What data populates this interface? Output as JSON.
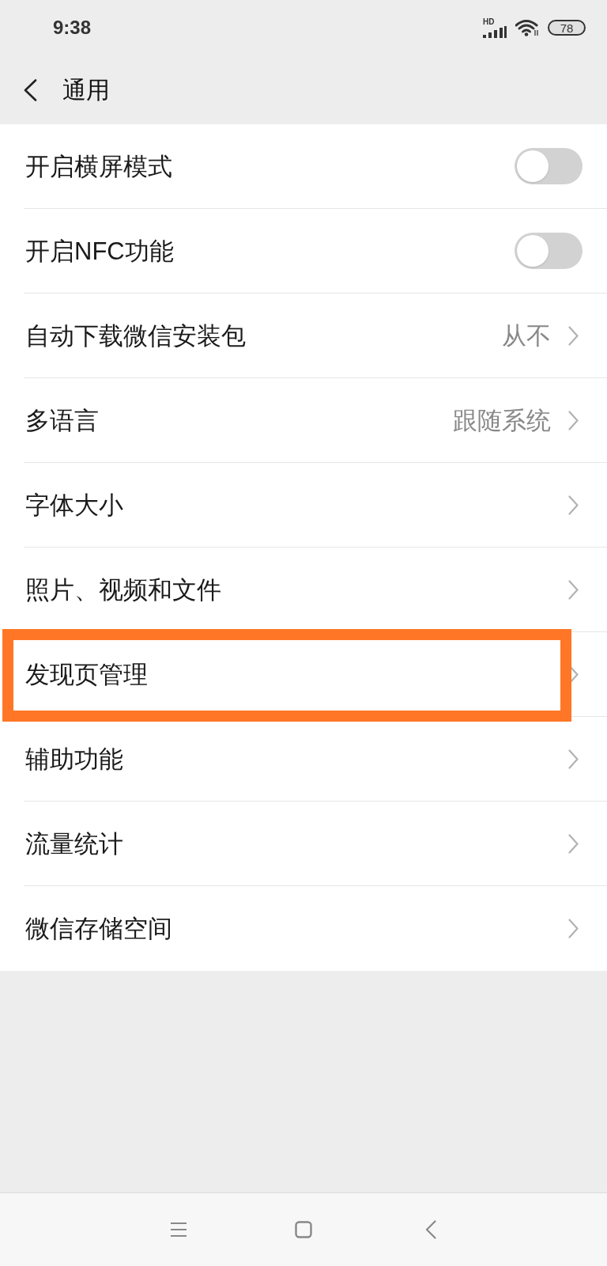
{
  "status_bar": {
    "time": "9:38",
    "network": "HD",
    "battery": "78"
  },
  "header": {
    "title": "通用"
  },
  "items": [
    {
      "kind": "toggle",
      "label": "开启横屏模式",
      "on": false,
      "highlighted": false
    },
    {
      "kind": "toggle",
      "label": "开启NFC功能",
      "on": false,
      "highlighted": false
    },
    {
      "kind": "link",
      "label": "自动下载微信安装包",
      "value": "从不",
      "highlighted": false
    },
    {
      "kind": "link",
      "label": "多语言",
      "value": "跟随系统",
      "highlighted": false
    },
    {
      "kind": "link",
      "label": "字体大小",
      "highlighted": false
    },
    {
      "kind": "link",
      "label": "照片、视频和文件",
      "highlighted": false
    },
    {
      "kind": "link",
      "label": "发现页管理",
      "highlighted": true
    },
    {
      "kind": "link",
      "label": "辅助功能",
      "highlighted": false
    },
    {
      "kind": "link",
      "label": "流量统计",
      "highlighted": false
    },
    {
      "kind": "link",
      "label": "微信存储空间",
      "highlighted": false
    }
  ]
}
